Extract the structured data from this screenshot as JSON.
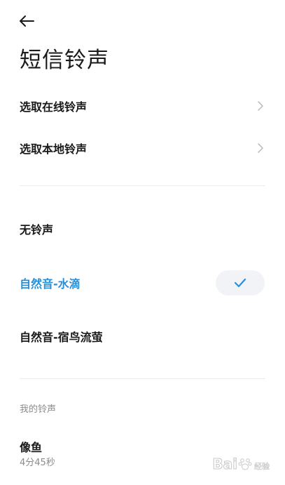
{
  "header": {
    "back_icon": "arrow-left-icon",
    "title": "短信铃声"
  },
  "nav_options": [
    {
      "label": "选取在线铃声",
      "icon": "chevron-right-icon"
    },
    {
      "label": "选取本地铃声",
      "icon": "chevron-right-icon"
    }
  ],
  "ringtones": [
    {
      "label": "无铃声",
      "selected": false
    },
    {
      "label": "自然音-水滴",
      "selected": true
    },
    {
      "label": "自然音-宿鸟流萤",
      "selected": false
    }
  ],
  "my_ringtones": {
    "header": "我的铃声",
    "items": [
      {
        "title": "像鱼",
        "duration": "4分45秒"
      }
    ]
  },
  "watermark": {
    "text": "Bai",
    "suffix": "经验"
  },
  "colors": {
    "accent": "#2a8fd6",
    "selected_pill": "#f1f3f6",
    "divider": "#ececec",
    "secondary_text": "#8c8c8c"
  }
}
